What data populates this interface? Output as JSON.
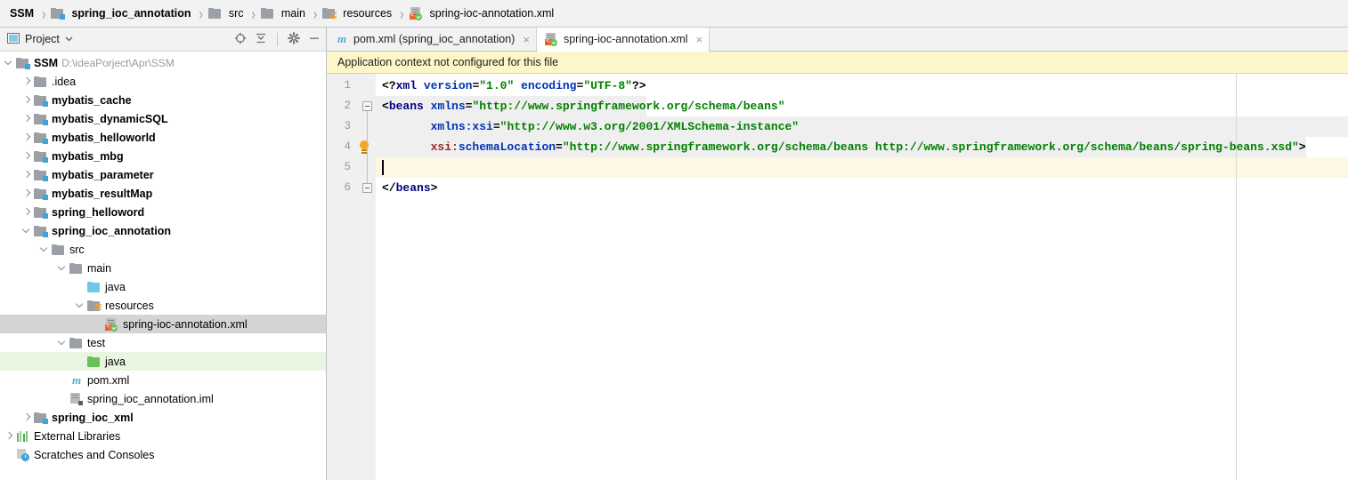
{
  "breadcrumb": {
    "items": [
      {
        "label": "SSM",
        "icon": "none",
        "bold": true
      },
      {
        "label": "spring_ioc_annotation",
        "icon": "module-icon",
        "bold": true
      },
      {
        "label": "src",
        "icon": "folder-icon",
        "bold": false
      },
      {
        "label": "main",
        "icon": "folder-icon",
        "bold": false
      },
      {
        "label": "resources",
        "icon": "resources-folder-icon",
        "bold": false
      },
      {
        "label": "spring-ioc-annotation.xml",
        "icon": "spring-xml-icon",
        "bold": false
      }
    ],
    "separator": "›"
  },
  "project_panel": {
    "title": "Project",
    "dropdown_icon": "chevron-down-icon",
    "window_icon": "project-window-icon",
    "actions": [
      {
        "name": "locate-in-tree-icon",
        "glyph": "target"
      },
      {
        "name": "collapse-all-icon",
        "glyph": "collapse"
      },
      {
        "name": "settings-gear-icon",
        "glyph": "gear"
      },
      {
        "name": "hide-window-icon",
        "glyph": "minus"
      }
    ],
    "tree": [
      {
        "label": "SSM",
        "path": "D:\\ideaPorject\\Apr\\SSM",
        "icon": "module-icon",
        "arrow": "down",
        "indent": 0,
        "bold": true,
        "state": "normal"
      },
      {
        "label": ".idea",
        "path": "",
        "icon": "folder-icon",
        "arrow": "right",
        "indent": 1,
        "bold": false,
        "state": "normal"
      },
      {
        "label": "mybatis_cache",
        "path": "",
        "icon": "module-icon",
        "arrow": "right",
        "indent": 1,
        "bold": true,
        "state": "normal"
      },
      {
        "label": "mybatis_dynamicSQL",
        "path": "",
        "icon": "module-icon",
        "arrow": "right",
        "indent": 1,
        "bold": true,
        "state": "normal"
      },
      {
        "label": "mybatis_helloworld",
        "path": "",
        "icon": "module-icon",
        "arrow": "right",
        "indent": 1,
        "bold": true,
        "state": "normal"
      },
      {
        "label": "mybatis_mbg",
        "path": "",
        "icon": "module-icon",
        "arrow": "right",
        "indent": 1,
        "bold": true,
        "state": "normal"
      },
      {
        "label": "mybatis_parameter",
        "path": "",
        "icon": "module-icon",
        "arrow": "right",
        "indent": 1,
        "bold": true,
        "state": "normal"
      },
      {
        "label": "mybatis_resultMap",
        "path": "",
        "icon": "module-icon",
        "arrow": "right",
        "indent": 1,
        "bold": true,
        "state": "normal"
      },
      {
        "label": "spring_helloword",
        "path": "",
        "icon": "module-icon",
        "arrow": "right",
        "indent": 1,
        "bold": true,
        "state": "normal"
      },
      {
        "label": "spring_ioc_annotation",
        "path": "",
        "icon": "module-icon",
        "arrow": "down",
        "indent": 1,
        "bold": true,
        "state": "normal"
      },
      {
        "label": "src",
        "path": "",
        "icon": "folder-icon",
        "arrow": "down",
        "indent": 2,
        "bold": false,
        "state": "normal"
      },
      {
        "label": "main",
        "path": "",
        "icon": "folder-icon",
        "arrow": "down",
        "indent": 3,
        "bold": false,
        "state": "normal"
      },
      {
        "label": "java",
        "path": "",
        "icon": "sources-folder-icon",
        "arrow": "none",
        "indent": 4,
        "bold": false,
        "state": "normal"
      },
      {
        "label": "resources",
        "path": "",
        "icon": "resources-folder-icon",
        "arrow": "down",
        "indent": 4,
        "bold": false,
        "state": "normal"
      },
      {
        "label": "spring-ioc-annotation.xml",
        "path": "",
        "icon": "spring-xml-icon",
        "arrow": "none",
        "indent": 5,
        "bold": false,
        "state": "selected"
      },
      {
        "label": "test",
        "path": "",
        "icon": "folder-icon",
        "arrow": "down",
        "indent": 3,
        "bold": false,
        "state": "normal"
      },
      {
        "label": "java",
        "path": "",
        "icon": "test-sources-folder-icon",
        "arrow": "none",
        "indent": 4,
        "bold": false,
        "state": "testroot"
      },
      {
        "label": "pom.xml",
        "path": "",
        "icon": "maven-icon",
        "arrow": "none",
        "indent": 3,
        "bold": false,
        "state": "normal"
      },
      {
        "label": "spring_ioc_annotation.iml",
        "path": "",
        "icon": "iml-icon",
        "arrow": "none",
        "indent": 3,
        "bold": false,
        "state": "normal"
      },
      {
        "label": "spring_ioc_xml",
        "path": "",
        "icon": "module-icon",
        "arrow": "right",
        "indent": 1,
        "bold": true,
        "state": "normal"
      },
      {
        "label": "External Libraries",
        "path": "",
        "icon": "libraries-icon",
        "arrow": "right",
        "indent": 0,
        "bold": false,
        "state": "normal"
      },
      {
        "label": "Scratches and Consoles",
        "path": "",
        "icon": "scratches-icon",
        "arrow": "none",
        "indent": 0,
        "bold": false,
        "state": "normal"
      }
    ]
  },
  "editor": {
    "tabs": [
      {
        "label": "pom.xml (spring_ioc_annotation)",
        "icon": "maven-icon",
        "active": false,
        "close_glyph": "×"
      },
      {
        "label": "spring-ioc-annotation.xml",
        "icon": "spring-xml-icon",
        "active": true,
        "close_glyph": "×"
      }
    ],
    "notification": {
      "message": "Application context not configured for this file"
    },
    "gutter": {
      "line_numbers": [
        "1",
        "2",
        "3",
        "4",
        "5",
        "6"
      ],
      "fold_markers": [
        {
          "line": 2,
          "type": "collapse"
        },
        {
          "line": 6,
          "type": "collapse-end"
        }
      ],
      "intention_bulb_line": 4
    },
    "code": {
      "caret_line": 5,
      "highlighted_block": [
        2,
        4
      ],
      "lines": [
        {
          "number": 1,
          "tokens": [
            {
              "text": "<?",
              "cls": "t-punct"
            },
            {
              "text": "xml",
              "cls": "t-tag"
            },
            {
              "text": " ",
              "cls": "t-punct"
            },
            {
              "text": "version",
              "cls": "t-attr"
            },
            {
              "text": "=",
              "cls": "t-punct"
            },
            {
              "text": "\"1.0\"",
              "cls": "t-val"
            },
            {
              "text": " ",
              "cls": "t-punct"
            },
            {
              "text": "encoding",
              "cls": "t-attr"
            },
            {
              "text": "=",
              "cls": "t-punct"
            },
            {
              "text": "\"UTF-8\"",
              "cls": "t-val"
            },
            {
              "text": "?>",
              "cls": "t-punct"
            }
          ]
        },
        {
          "number": 2,
          "tokens": [
            {
              "text": "<",
              "cls": "t-punct"
            },
            {
              "text": "beans",
              "cls": "t-tag"
            },
            {
              "text": " ",
              "cls": "t-punct"
            },
            {
              "text": "xmlns",
              "cls": "t-attr"
            },
            {
              "text": "=",
              "cls": "t-punct"
            },
            {
              "text": "\"http://www.springframework.org/schema/beans\"",
              "cls": "t-val"
            }
          ]
        },
        {
          "number": 3,
          "tokens": [
            {
              "text": "       ",
              "cls": "t-punct"
            },
            {
              "text": "xmlns:xsi",
              "cls": "t-attr"
            },
            {
              "text": "=",
              "cls": "t-punct"
            },
            {
              "text": "\"http://www.w3.org/2001/XMLSchema-instance\"",
              "cls": "t-val"
            }
          ]
        },
        {
          "number": 4,
          "tokens": [
            {
              "text": "       ",
              "cls": "t-punct"
            },
            {
              "text": "xsi:",
              "cls": "t-pfx"
            },
            {
              "text": "schemaLocation",
              "cls": "t-attr"
            },
            {
              "text": "=",
              "cls": "t-punct"
            },
            {
              "text": "\"http://www.springframework.org/schema/beans http://www.springframework.org/schema/beans/spring-beans.xsd\"",
              "cls": "t-val"
            },
            {
              "text": ">",
              "cls": "t-punct"
            }
          ]
        },
        {
          "number": 5,
          "tokens": []
        },
        {
          "number": 6,
          "tokens": [
            {
              "text": "</",
              "cls": "t-punct"
            },
            {
              "text": "beans",
              "cls": "t-tag"
            },
            {
              "text": ">",
              "cls": "t-punct"
            }
          ]
        }
      ]
    }
  },
  "colors": {
    "tag": "#000080",
    "attribute": "#0033b3",
    "namespace_prefix": "#9c2a2a",
    "value": "#008000",
    "notification_bg": "#fdf6c8",
    "caret_line_bg": "#fdf8e4",
    "tag_block_bg": "#efefef",
    "selection_bg": "#d4d4d4",
    "test_root_bg": "#e9f5e1"
  }
}
